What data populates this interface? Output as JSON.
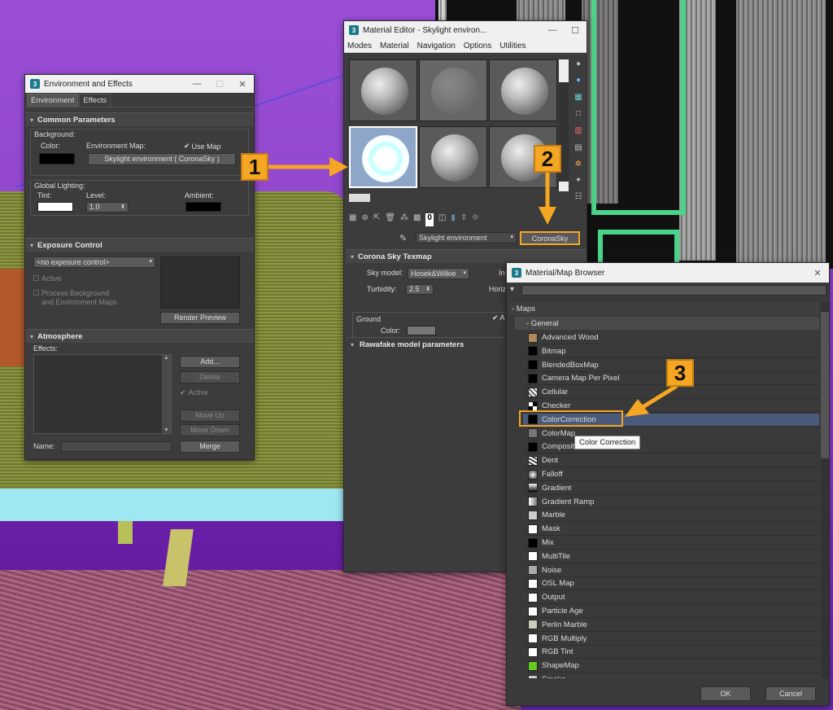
{
  "env_window": {
    "title": "Environment and Effects",
    "tabs": [
      "Environment",
      "Effects"
    ],
    "common_parameters": {
      "title": "Common Parameters",
      "background_label": "Background:",
      "color_label": "Color:",
      "env_map_label": "Environment Map:",
      "use_map_label": "Use Map",
      "env_map_button": "Skylight environment  ( CoronaSky )",
      "global_lighting_label": "Global Lighting:",
      "tint_label": "Tint:",
      "level_label": "Level:",
      "level_value": "1.0",
      "ambient_label": "Ambient:"
    },
    "exposure_control": {
      "title": "Exposure Control",
      "dropdown_value": "<no exposure control>",
      "active_label": "Active",
      "process_bg_label_1": "Process Background",
      "process_bg_label_2": "and Environment Maps",
      "render_preview_label": "Render Preview"
    },
    "atmosphere": {
      "title": "Atmosphere",
      "effects_label": "Effects:",
      "add_label": "Add...",
      "delete_label": "Delete",
      "active_label": "Active",
      "move_up_label": "Move Up",
      "move_down_label": "Move Down",
      "name_label": "Name:",
      "merge_label": "Merge"
    }
  },
  "mat_window": {
    "title": "Material Editor - Skylight environ...",
    "menus": [
      "Modes",
      "Material",
      "Navigation",
      "Options",
      "Utilities"
    ],
    "map_name": "Skylight environment",
    "map_type_button": "CoronaSky",
    "corona_sky": {
      "title": "Corona Sky Texmap",
      "sky_model_label": "Sky model:",
      "sky_model_value": "Hosek&Wilkie",
      "turbidity_label": "Turbidity:",
      "turbidity_value": "2.5",
      "in_label": "In",
      "horiz_label": "Horiz",
      "ground_label": "Ground",
      "color_label": "Color:",
      "a_label": "A"
    },
    "rawafake_title": "Rawafake model parameters"
  },
  "browser_window": {
    "title": "Material/Map Browser",
    "maps_label": "- Maps",
    "general_label": "- General",
    "items": [
      "Advanced Wood",
      "Bitmap",
      "BlendedBoxMap",
      "Camera Map Per Pixel",
      "Cellular",
      "Checker",
      "ColorCorrection",
      "ColorMap",
      "Composite",
      "Dent",
      "Falloff",
      "Gradient",
      "Gradient Ramp",
      "Marble",
      "Mask",
      "Mix",
      "MultiTile",
      "Noise",
      "OSL Map",
      "Output",
      "Particle Age",
      "Perlin Marble",
      "RGB Multiply",
      "RGB Tint",
      "ShapeMap",
      "Smoke"
    ],
    "tooltip": "Color Correction",
    "ok_label": "OK",
    "cancel_label": "Cancel"
  },
  "callouts": [
    "1",
    "2",
    "3"
  ],
  "colors": {
    "accent": "#f5a623",
    "selected_row": "#4a5a7a",
    "viewport_purple": "#8b3fc8"
  }
}
